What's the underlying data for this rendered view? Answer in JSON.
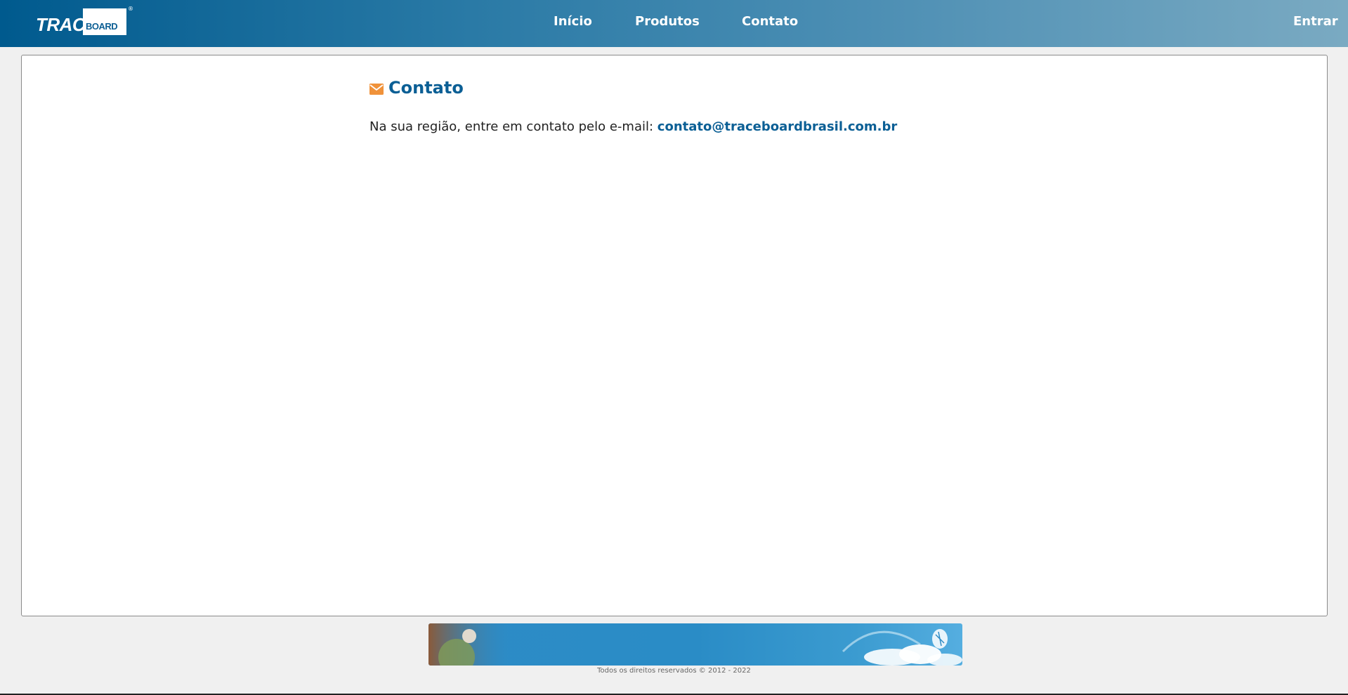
{
  "header": {
    "logo": {
      "trace": "TRACE",
      "board": "BOARD",
      "registered": "®"
    },
    "nav": {
      "inicio": "Início",
      "produtos": "Produtos",
      "contato": "Contato"
    },
    "login": "Entrar"
  },
  "main": {
    "heading": "Contato",
    "heading_icon": "envelope-icon",
    "contact_text": "Na sua região, entre em contato pelo e-mail:",
    "contact_email": "contato@traceboardbrasil.com.br"
  },
  "footer": {
    "copyright": "Todos os direitos reservados © 2012 - 2022"
  },
  "colors": {
    "brand_blue": "#0b5f95",
    "icon_orange": "#f0923a",
    "header_start": "#005a8e",
    "header_end": "#7aaac2"
  }
}
